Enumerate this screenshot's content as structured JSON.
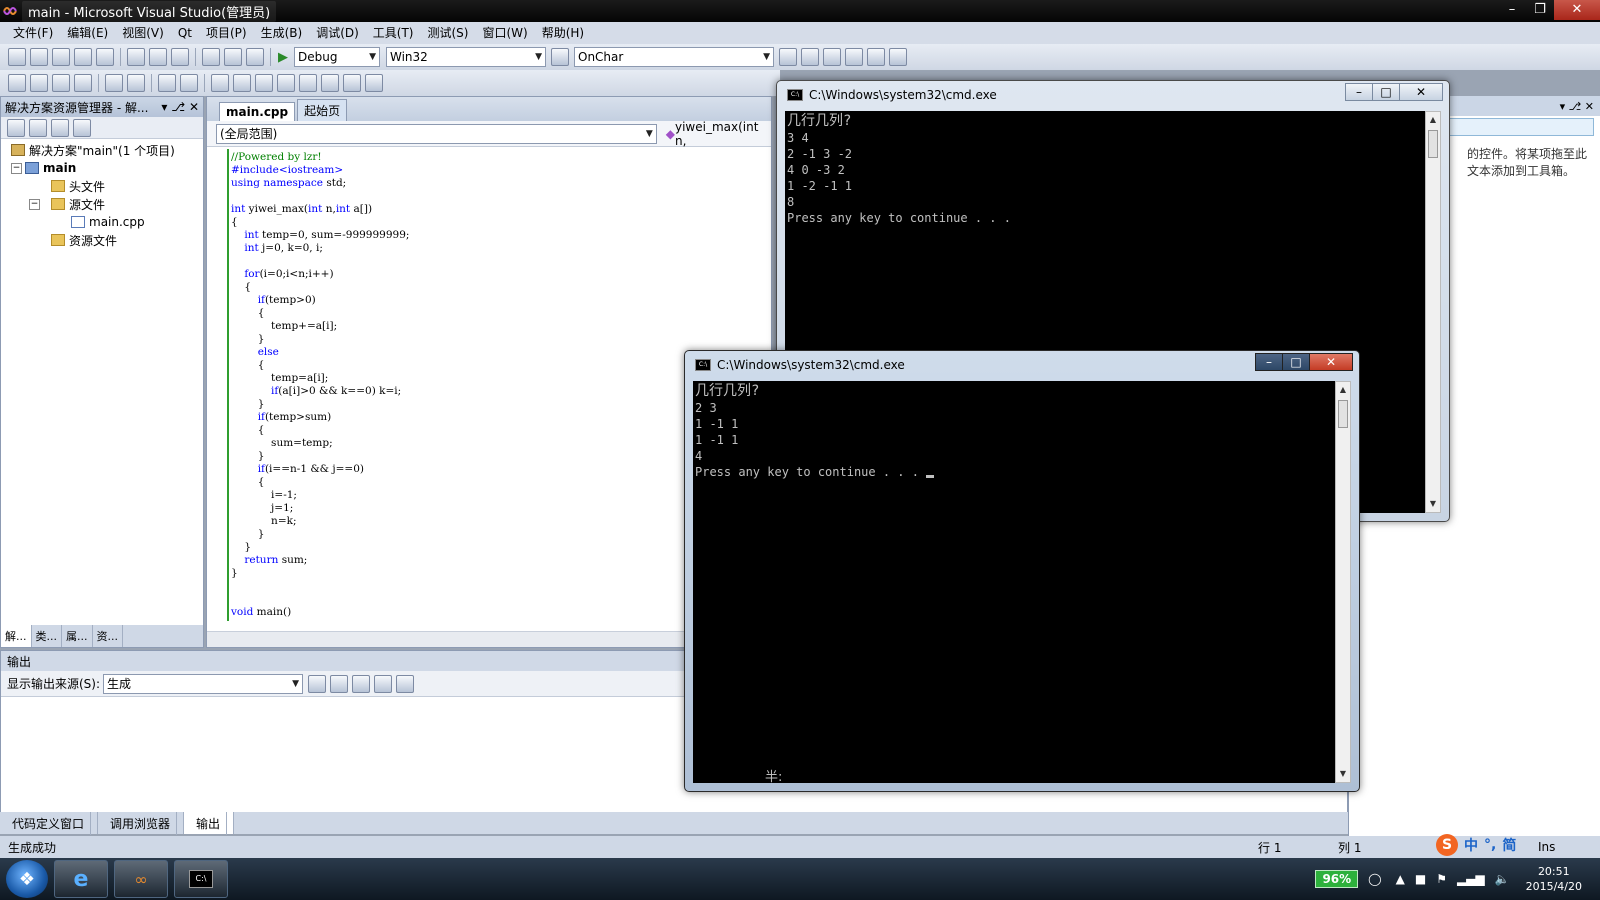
{
  "window": {
    "title": "main - Microsoft Visual Studio(管理员)"
  },
  "menu": [
    "文件(F)",
    "编辑(E)",
    "视图(V)",
    "Qt",
    "项目(P)",
    "生成(B)",
    "调试(D)",
    "工具(T)",
    "测试(S)",
    "窗口(W)",
    "帮助(H)"
  ],
  "toolbar": {
    "config": "Debug",
    "platform": "Win32",
    "find": "OnChar"
  },
  "solution_explorer": {
    "title": "解决方案资源管理器 - 解...",
    "solution": "解决方案\"main\"(1 个项目)",
    "project": "main",
    "header_files": "头文件",
    "source_files": "源文件",
    "main_cpp": "main.cpp",
    "resource_files": "资源文件",
    "tabs": [
      "解...",
      "类...",
      "属...",
      "资..."
    ]
  },
  "editor": {
    "tabs": [
      "main.cpp",
      "起始页"
    ],
    "scope": "(全局范围)",
    "func": "yiwei_max(int n,",
    "lines": {
      "l1": "//Powered by lzr!",
      "l2": "#include<iostream>",
      "l3a": "using namespace",
      "l3b": " std;",
      "l4a": "int",
      "l4b": " yiwei_max(",
      "l4c": "int",
      "l4d": " n,",
      "l4e": "int",
      "l4f": " a[])",
      "l5": "{",
      "l6a": "    int",
      "l6b": " temp=0, sum=-999999999;",
      "l7a": "    int",
      "l7b": " j=0, k=0, i;",
      "l8a": "    for",
      "l8b": "(i=0;i<n;i++)",
      "l9": "    {",
      "l10a": "        if",
      "l10b": "(temp>0)",
      "l11": "        {",
      "l12": "            temp+=a[i];",
      "l13": "        }",
      "l14": "        else",
      "l15": "        {",
      "l16": "            temp=a[i];",
      "l17a": "            if",
      "l17b": "(a[i]>0 && k==0) k=i;",
      "l18": "        }",
      "l19a": "        if",
      "l19b": "(temp>sum)",
      "l20": "        {",
      "l21": "            sum=temp;",
      "l22": "        }",
      "l23a": "        if",
      "l23b": "(i==n-1 && j==0)",
      "l24": "        {",
      "l25": "            i=-1;",
      "l26": "            j=1;",
      "l27": "            n=k;",
      "l28": "        }",
      "l29": "    }",
      "l30a": "    return",
      "l30b": " sum;",
      "l31": "}",
      "l32a": "void",
      "l32b": " main()"
    }
  },
  "output": {
    "title": "输出",
    "source_label": "显示输出来源(S):",
    "source_value": "生成",
    "tabs": [
      "代码定义窗口",
      "调用浏览器",
      "输出"
    ]
  },
  "right_panel": {
    "text": "的控件。将某项拖至此文本添加到工具箱。"
  },
  "status": {
    "left": "生成成功",
    "row": "行 1",
    "col": "列 1",
    "ins": "Ins"
  },
  "cmd1": {
    "title": "C:\\Windows\\system32\\cmd.exe",
    "question": "几行几列?",
    "lines": [
      "3 4",
      "2 -1 3 -2",
      "4 0 -3 2",
      "1 -2 -1 1",
      "8",
      "Press any key to continue . . ."
    ]
  },
  "cmd2": {
    "title": "C:\\Windows\\system32\\cmd.exe",
    "question": "几行几列?",
    "lines": [
      "2 3",
      "1 -1 1",
      "1 -1 1",
      "4",
      "Press any key to continue . . ."
    ],
    "ime": "半:"
  },
  "ime_bar": {
    "logo": "S",
    "lang": "中",
    "punct": "°,",
    "mode": "简"
  },
  "taskbar": {
    "battery": "96%",
    "time": "20:51",
    "date": "2015/4/20"
  }
}
